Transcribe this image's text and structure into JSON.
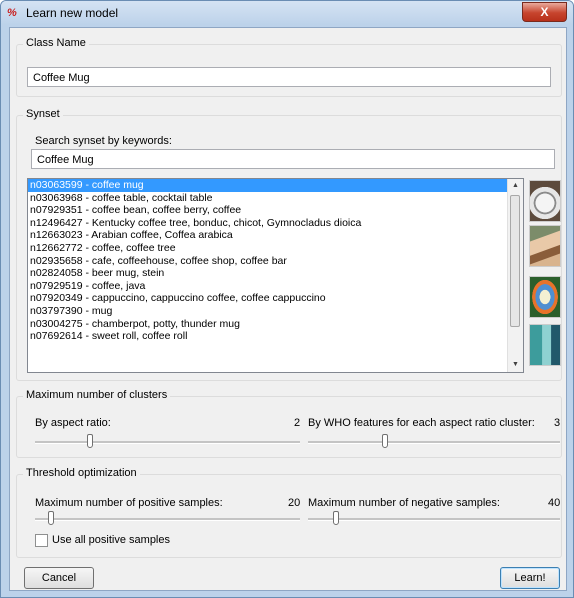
{
  "window": {
    "title": "Learn new model",
    "app_icon": "%",
    "close_glyph": "X"
  },
  "class_name": {
    "group_label": "Class Name",
    "value": "Coffee Mug"
  },
  "synset": {
    "group_label": "Synset",
    "search_label": "Search synset by keywords:",
    "search_value": "Coffee Mug",
    "items": [
      {
        "text": "n03063599  -  coffee mug",
        "selected": true
      },
      {
        "text": "n03063968  -  coffee table, cocktail table",
        "selected": false
      },
      {
        "text": "n07929351  -  coffee bean, coffee berry, coffee",
        "selected": false
      },
      {
        "text": "n12496427  -  Kentucky coffee tree, bonduc, chicot, Gymnocladus dioica",
        "selected": false
      },
      {
        "text": "n12663023  -  Arabian coffee, Coffea arabica",
        "selected": false
      },
      {
        "text": "n12662772  -  coffee, coffee tree",
        "selected": false
      },
      {
        "text": "n02935658  -  cafe, coffeehouse, coffee shop, coffee bar",
        "selected": false
      },
      {
        "text": "n02824058  -  beer mug, stein",
        "selected": false
      },
      {
        "text": "n07929519  -  coffee, java",
        "selected": false
      },
      {
        "text": "n07920349  -  cappuccino, cappuccino coffee, coffee cappuccino",
        "selected": false
      },
      {
        "text": "n03797390  -  mug",
        "selected": false
      },
      {
        "text": "n03004275  -  chamberpot, potty, thunder mug",
        "selected": false
      },
      {
        "text": "n07692614  -  sweet roll, coffee roll",
        "selected": false
      }
    ],
    "thumbnail_icons": [
      "coffee-cup-photo",
      "child-with-mug-photo",
      "cartoon-mug-photo",
      "mug-lettering-photo"
    ]
  },
  "clusters": {
    "group_label": "Maximum number of clusters",
    "aspect_label": "By aspect ratio:",
    "aspect_value": "2",
    "aspect_slider_fraction": 0.2,
    "who_label": "By WHO features for each aspect ratio cluster:",
    "who_value": "3",
    "who_slider_fraction": 0.3
  },
  "threshold": {
    "group_label": "Threshold optimization",
    "pos_label": "Maximum number of positive samples:",
    "pos_value": "20",
    "pos_slider_fraction": 0.05,
    "neg_label": "Maximum number of negative samples:",
    "neg_value": "40",
    "neg_slider_fraction": 0.1,
    "use_all_label": "Use all positive samples",
    "use_all_checked": false
  },
  "buttons": {
    "cancel": "Cancel",
    "learn": "Learn!"
  },
  "colors": {
    "selection": "#3399ff",
    "title_icon": "#c81e1e",
    "close_button": "#c7442d"
  }
}
